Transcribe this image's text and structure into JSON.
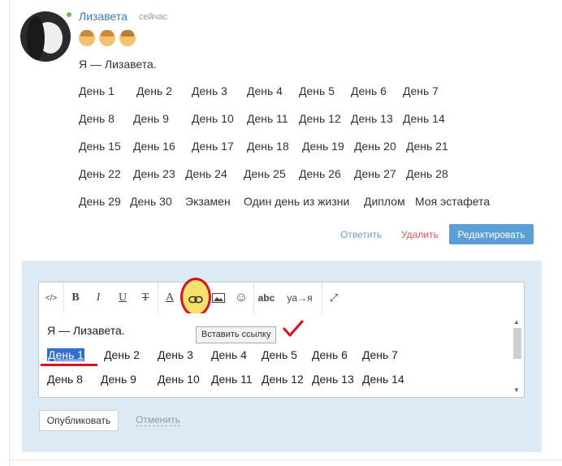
{
  "author": {
    "name": "Лизавета",
    "time": "сейчас",
    "online_color": "#6cc04a"
  },
  "post": {
    "emojis": [
      "girl-emoji",
      "girl-emoji",
      "boy-emoji"
    ],
    "intro": "Я — Лизавета.",
    "day_rows": [
      [
        "День 1",
        "День 2",
        "День 3",
        "День 4",
        "День 5",
        "День 6",
        "День 7"
      ],
      [
        "День 8",
        "День 9",
        "День 10",
        "День 11",
        "День 12",
        "День 13",
        "День 14"
      ],
      [
        "День 15",
        "День 16",
        "День 17",
        "День 18",
        "День 19",
        "День 20",
        "День 21"
      ],
      [
        "День 22",
        "День 23",
        "День 24",
        "День 25",
        "День 26",
        "День 27",
        "День 28"
      ],
      [
        "День 29",
        "День 30",
        "Экзамен",
        "Один день из жизни",
        "Диплом",
        "Моя эстафета"
      ]
    ]
  },
  "actions": {
    "reply": "Ответить",
    "delete": "Удалить",
    "edit": "Редактировать"
  },
  "toolbar": {
    "html": "</>",
    "bold": "B",
    "italic": "I",
    "underline": "U",
    "strike": "T",
    "color": "A",
    "link_icon": "link-icon",
    "image_icon": "image-icon",
    "smile_icon": "smile-icon",
    "spellcheck": "abc",
    "translit": "ya→я",
    "expand_icon": "expand-icon",
    "tooltip": "Вставить ссылку"
  },
  "editor": {
    "intro": "Я — Лизавета.",
    "rows": [
      [
        "День 1",
        "День 2",
        "День 3",
        "День 4",
        "День 5",
        "День 6",
        "День 7"
      ],
      [
        "День 8",
        "День 9",
        "День 10",
        "День 11",
        "День 12",
        "День 13",
        "День 14"
      ]
    ],
    "selected": "День 1"
  },
  "buttons": {
    "publish": "Опубликовать",
    "cancel": "Отменить"
  },
  "colors": {
    "accent": "#5b9fd6",
    "link": "#3a7ab8",
    "delete": "#d4595b",
    "annotation": "#e0101a",
    "panel": "#dbeaf5"
  }
}
